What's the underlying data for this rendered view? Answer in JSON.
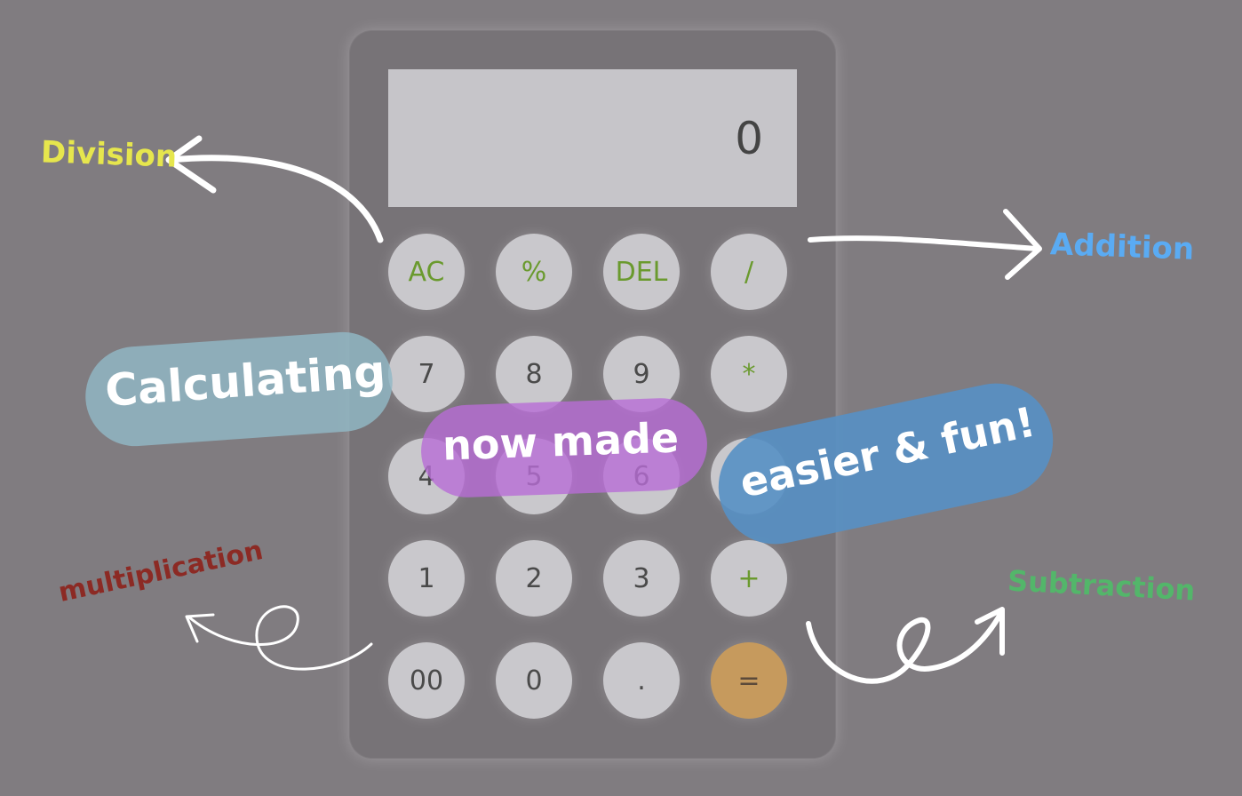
{
  "calculator": {
    "display": "0",
    "keys": [
      {
        "label": "AC",
        "role": "op"
      },
      {
        "label": "%",
        "role": "op"
      },
      {
        "label": "DEL",
        "role": "op"
      },
      {
        "label": "/",
        "role": "op"
      },
      {
        "label": "7",
        "role": "num"
      },
      {
        "label": "8",
        "role": "num"
      },
      {
        "label": "9",
        "role": "num"
      },
      {
        "label": "*",
        "role": "op"
      },
      {
        "label": "4",
        "role": "num"
      },
      {
        "label": "5",
        "role": "num"
      },
      {
        "label": "6",
        "role": "num"
      },
      {
        "label": "-",
        "role": "op"
      },
      {
        "label": "1",
        "role": "num"
      },
      {
        "label": "2",
        "role": "num"
      },
      {
        "label": "3",
        "role": "num"
      },
      {
        "label": "+",
        "role": "op"
      },
      {
        "label": "00",
        "role": "num"
      },
      {
        "label": "0",
        "role": "num"
      },
      {
        "label": ".",
        "role": "num"
      },
      {
        "label": "=",
        "role": "equals"
      }
    ],
    "colors": {
      "background": "#807c80",
      "body": "#777377",
      "display": "#c6c5c9",
      "key": "#c9c8cc",
      "operator_text": "#6a9a2e",
      "equals_key": "#c69a5d"
    }
  },
  "annotations": {
    "division": {
      "text": "Division",
      "color": "#e6e64d"
    },
    "addition": {
      "text": "Addition",
      "color": "#5aabf3"
    },
    "multiplication": {
      "text": "multiplication",
      "color": "#8c2a24"
    },
    "subtraction": {
      "text": "Subtraction",
      "color": "#53b66a"
    }
  },
  "slogan": {
    "part1": "Calculating",
    "part2": "now made",
    "part3": "easier & fun!"
  }
}
